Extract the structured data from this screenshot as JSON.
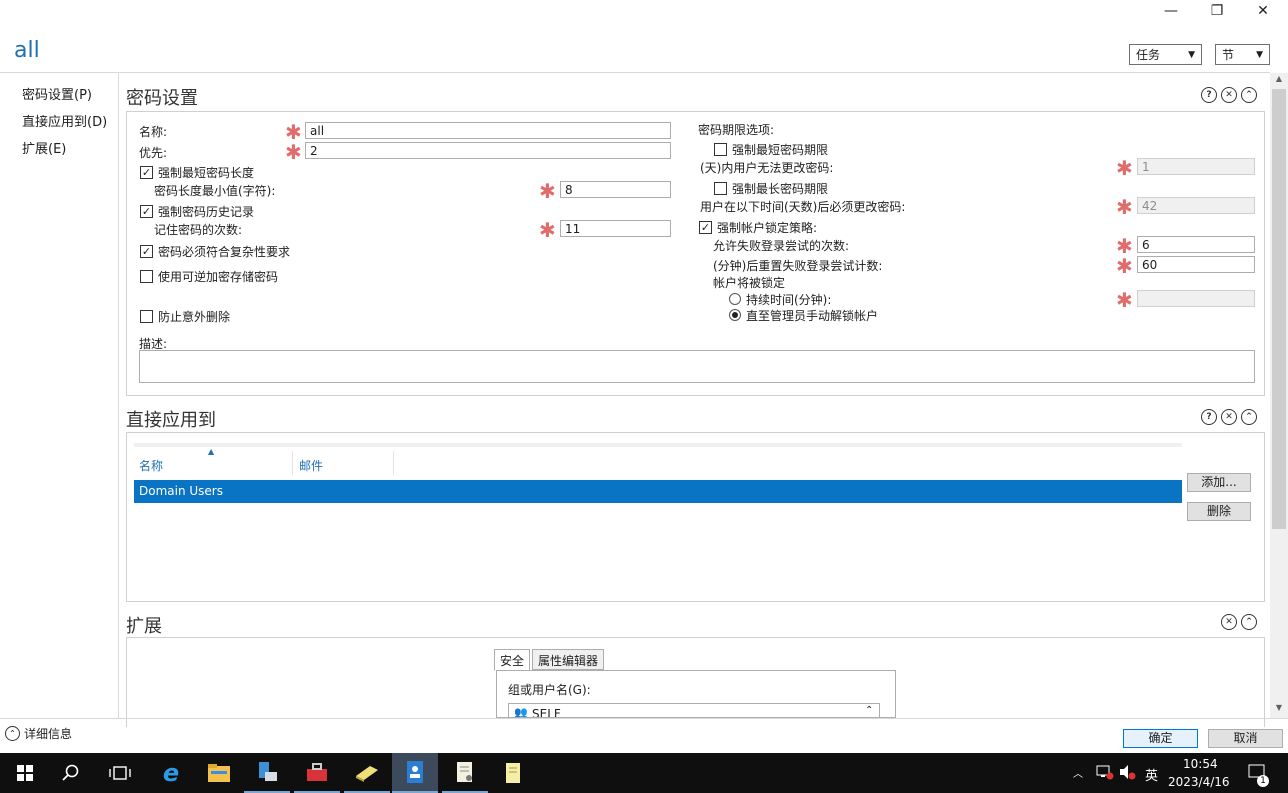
{
  "window": {
    "title": "all",
    "caption": {
      "minimize": "—",
      "restore": "❐",
      "close": "✕"
    },
    "menus": {
      "tasks": "任务",
      "sections": "节"
    }
  },
  "nav": {
    "items": [
      "密码设置(P)",
      "直接应用到(D)",
      "扩展(E)"
    ]
  },
  "password_settings": {
    "title": "密码设置",
    "name_label": "名称:",
    "name_value": "all",
    "priority_label": "优先:",
    "priority_value": "2",
    "enforce_min_length": {
      "label": "强制最短密码长度",
      "checked": true
    },
    "min_length_label": "密码长度最小值(字符):",
    "min_length_value": "8",
    "enforce_history": {
      "label": "强制密码历史记录",
      "checked": true
    },
    "history_label": "记住密码的次数:",
    "history_value": "11",
    "complexity": {
      "label": "密码必须符合复杂性要求",
      "checked": true
    },
    "reversible": {
      "label": "使用可逆加密存储密码",
      "checked": false
    },
    "protect_delete": {
      "label": "防止意外删除",
      "checked": false
    },
    "description_label": "描述:",
    "age_options_label": "密码期限选项:",
    "enforce_min_age": {
      "label": "强制最短密码期限",
      "checked": false
    },
    "min_age_label": "(天)内用户无法更改密码:",
    "min_age_value": "1",
    "enforce_max_age": {
      "label": "强制最长密码期限",
      "checked": false
    },
    "max_age_label": "用户在以下时间(天数)后必须更改密码:",
    "max_age_value": "42",
    "lockout_policy": {
      "label": "强制帐户锁定策略:",
      "checked": true
    },
    "failed_attempts_label": "允许失败登录尝试的次数:",
    "failed_attempts_value": "6",
    "reset_after_label": "(分钟)后重置失败登录尝试计数:",
    "reset_after_value": "60",
    "lockout_label": "帐户将被锁定",
    "duration_option": {
      "label": "持续时间(分钟):",
      "selected": false
    },
    "until_admin_option": {
      "label": "直至管理员手动解锁帐户",
      "selected": true
    }
  },
  "applies_to": {
    "title": "直接应用到",
    "columns": [
      "名称",
      "邮件"
    ],
    "rows": [
      {
        "name": "Domain Users",
        "email": ""
      }
    ],
    "add_button": "添加...",
    "remove_button": "删除"
  },
  "extensions": {
    "title": "扩展",
    "tabs": [
      "安全",
      "属性编辑器"
    ],
    "group_label": "组或用户名(G):",
    "first_entry": "SELF"
  },
  "footer": {
    "details": "详细信息",
    "ok_button": "确定",
    "cancel_button": "取消"
  },
  "taskbar": {
    "time": "10:54",
    "date": "2023/4/16",
    "ime": "英",
    "notification_count": "1"
  },
  "colors": {
    "accent": "#0a74c4",
    "title": "#1f6fb5",
    "required": "#e06c6c"
  }
}
